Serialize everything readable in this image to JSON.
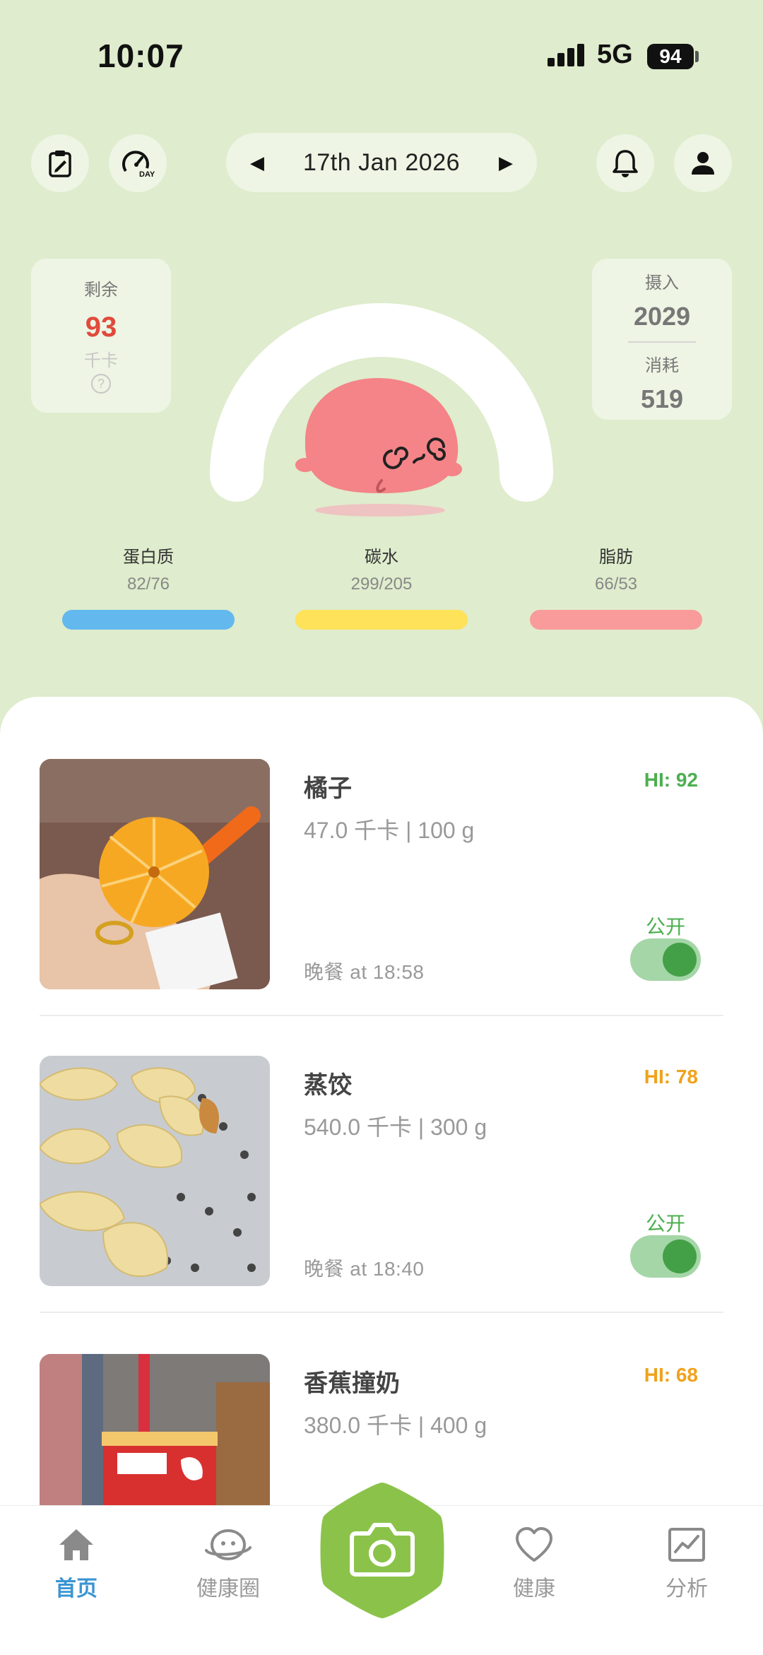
{
  "status_bar": {
    "time": "10:07",
    "network": "5G",
    "battery": "94"
  },
  "header": {
    "date": "17th Jan 2026",
    "prev_icon": "caret-left-icon",
    "next_icon": "caret-right-icon"
  },
  "stats": {
    "remaining": {
      "label": "剩余",
      "value": "93",
      "unit": "千卡"
    },
    "intake": {
      "label": "摄入",
      "value": "2029"
    },
    "burned": {
      "label": "消耗",
      "value": "519"
    },
    "gauge_fraction": 1.0
  },
  "macros": [
    {
      "label": "蛋白质",
      "value": "82/76",
      "color": "#63b8ee"
    },
    {
      "label": "碳水",
      "value": "299/205",
      "color": "#fde25a"
    },
    {
      "label": "脂肪",
      "value": "66/53",
      "color": "#f99b9b"
    }
  ],
  "meals": [
    {
      "name": "橘子",
      "cal": "47.0 千卡 | 100 g",
      "meal": "晚餐 at 18:58",
      "hi": "HI: 92",
      "hi_color": "#4caf50",
      "public_label": "公开",
      "public": true
    },
    {
      "name": "蒸饺",
      "cal": "540.0 千卡 | 300 g",
      "meal": "晚餐 at 18:40",
      "hi": "HI: 78",
      "hi_color": "#f0a21b",
      "public_label": "公开",
      "public": true
    },
    {
      "name": "香蕉撞奶",
      "cal": "380.0 千卡 | 400 g",
      "hi": "HI: 68",
      "hi_color": "#f0a21b"
    }
  ],
  "tabs": [
    {
      "label": "首页",
      "icon": "home-icon",
      "active": true
    },
    {
      "label": "健康圈",
      "icon": "planet-icon",
      "active": false
    },
    {
      "label": "健康",
      "icon": "heart-icon",
      "active": false
    },
    {
      "label": "分析",
      "icon": "chart-icon",
      "active": false
    }
  ],
  "colors": {
    "bg": "#dfeccd",
    "accent_green": "#8bc34a",
    "active_tab": "#3a95d3"
  }
}
